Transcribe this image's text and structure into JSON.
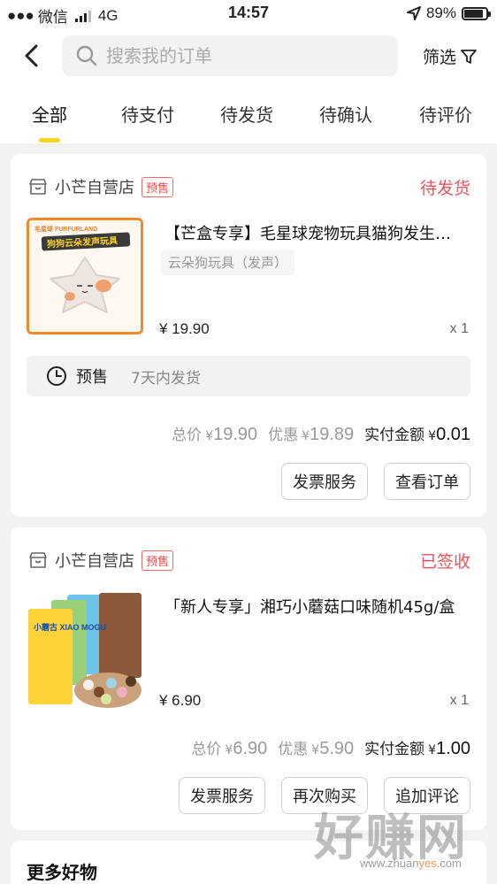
{
  "status_bar": {
    "carrier": "微信",
    "network": "4G",
    "time": "14:57",
    "battery": "89%",
    "battery_level": 0.89
  },
  "header": {
    "search_placeholder": "搜索我的订单",
    "filter_label": "筛选",
    "tabs": [
      "全部",
      "待支付",
      "待发货",
      "待确认",
      "待评价"
    ],
    "active_tab": 0
  },
  "orders": [
    {
      "store": "小芒自营店",
      "badge": "预售",
      "status": "待发货",
      "status_color": "#f0505a",
      "title": "【芒盒专享】毛星球宠物玩具猫狗发生…",
      "spec": "云朵狗玩具（发声）",
      "image": {
        "brand": "毛星球 FURFURLAND",
        "banner": "狗狗云朵发声玩具"
      },
      "price": "¥ 19.90",
      "quantity": "x 1",
      "presale_label": "预售",
      "presale_note": "7天内发货",
      "total_label": "总价",
      "total_value": "19.90",
      "discount_label": "优惠",
      "discount_value": "19.89",
      "paid_label": "实付金额",
      "paid_value": "0.01",
      "buttons": [
        "发票服务",
        "查看订单"
      ]
    },
    {
      "store": "小芒自营店",
      "badge": "预售",
      "status": "已签收",
      "status_color": "#f0505a",
      "title": "「新人专享」湘巧小蘑菇口味随机45g/盒",
      "image": {
        "brand": "小蘑古 XIAO MOGU"
      },
      "price": "¥ 6.90",
      "quantity": "x 1",
      "total_label": "总价",
      "total_value": "6.90",
      "discount_label": "优惠",
      "discount_value": "5.90",
      "paid_label": "实付金额",
      "paid_value": "1.00",
      "buttons": [
        "发票服务",
        "再次购买",
        "追加评论"
      ]
    }
  ],
  "more_section_title": "更多好物",
  "watermark": {
    "big": "好赚网",
    "small_prefix": "www.zhuan",
    "small_accent": "yes",
    "small_suffix": ".com"
  },
  "colors": {
    "accent_yellow": "#ffd21e",
    "status_red": "#f0505a",
    "badge_red": "#e84a4a"
  }
}
